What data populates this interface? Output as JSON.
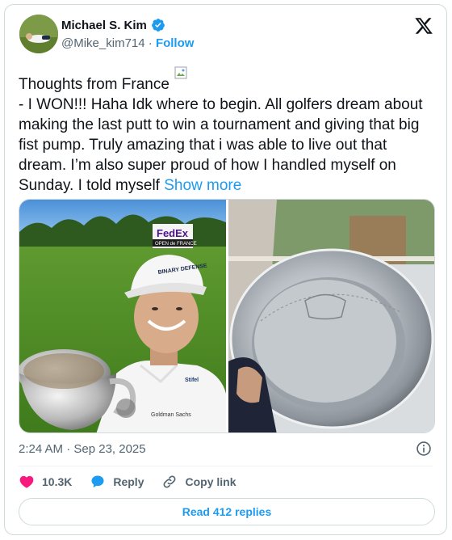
{
  "author": {
    "name": "Michael S. Kim",
    "handle": "@Mike_kim714",
    "separator": "·",
    "follow_label": "Follow",
    "verified_icon": "verified-badge-icon"
  },
  "tweet": {
    "text_main": "Thoughts from France",
    "text_body": "- I WON!!! Haha Idk where to begin. All golfers dream about making the last putt to win a tournament and giving that big fist pump. Truly amazing that i was able to live out that dream. I’m also super proud of how I handled myself on Sunday. I told myself",
    "show_more": "Show more"
  },
  "media": {
    "left_sign_brand": "FedEx",
    "left_sign_sub": "OPEN de FRANCE",
    "cap_text": "BINARY DEFENSE",
    "shirt_logo": "Stifel",
    "shirt_text": "Goldman Sachs"
  },
  "timestamp": "2:24 AM · Sep 23, 2025",
  "actions": {
    "likes": "10.3K",
    "reply": "Reply",
    "copy_link": "Copy link"
  },
  "read_replies": "Read 412 replies",
  "colors": {
    "accent": "#1d9bf0",
    "like": "#f91880",
    "text": "#0f1419",
    "muted": "#536471",
    "border": "#cfd9de"
  }
}
